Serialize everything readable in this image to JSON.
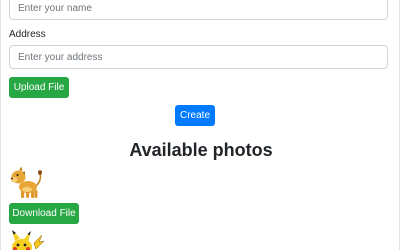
{
  "form": {
    "name_placeholder": "Enter your name",
    "address_label": "Address",
    "address_placeholder": "Enter your address",
    "upload_label": "Upload File",
    "create_label": "Create"
  },
  "photos": {
    "title": "Available photos",
    "items": [
      {
        "image": "lion-cartoon-image",
        "download_label": "Download File"
      },
      {
        "image": "pikachu-cartoon-image"
      }
    ]
  },
  "colors": {
    "success": "#28a745",
    "primary": "#007bff",
    "border": "#ced4da"
  }
}
